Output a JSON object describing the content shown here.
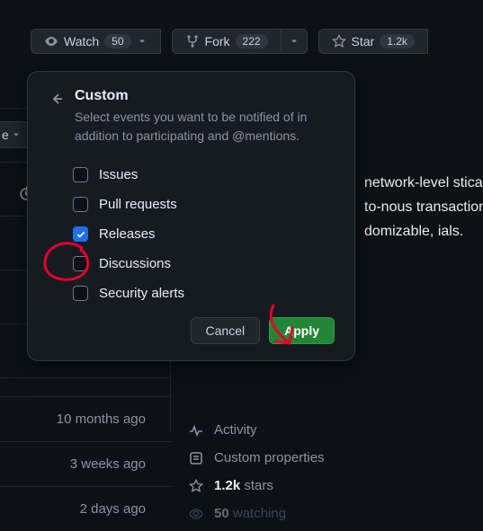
{
  "actions": {
    "watch": {
      "label": "Watch",
      "count": "50"
    },
    "fork": {
      "label": "Fork",
      "count": "222"
    },
    "star": {
      "label": "Star",
      "count": "1.2k"
    }
  },
  "popover": {
    "title": "Custom",
    "description": "Select events you want to be notified of in addition to participating and @mentions.",
    "options": {
      "issues": {
        "label": "Issues",
        "checked": false
      },
      "pulls": {
        "label": "Pull requests",
        "checked": false
      },
      "releases": {
        "label": "Releases",
        "checked": true
      },
      "disc": {
        "label": "Discussions",
        "checked": false
      },
      "security": {
        "label": "Security alerts",
        "checked": false
      }
    },
    "cancel": "Cancel",
    "apply": "Apply"
  },
  "bg": {
    "desc_fragment": "network-level sticated end-to-nous transactions domizable, ials.",
    "sidebar": {
      "activity": "Activity",
      "custom_props": "Custom properties",
      "stars": {
        "count": "1.2k",
        "suffix": "stars"
      },
      "watching": {
        "count": "50",
        "suffix": "watching"
      }
    },
    "times": {
      "t1": "10 months ago",
      "t2": "3 weeks ago",
      "t3": "2 days ago"
    },
    "chip_text": "e"
  }
}
